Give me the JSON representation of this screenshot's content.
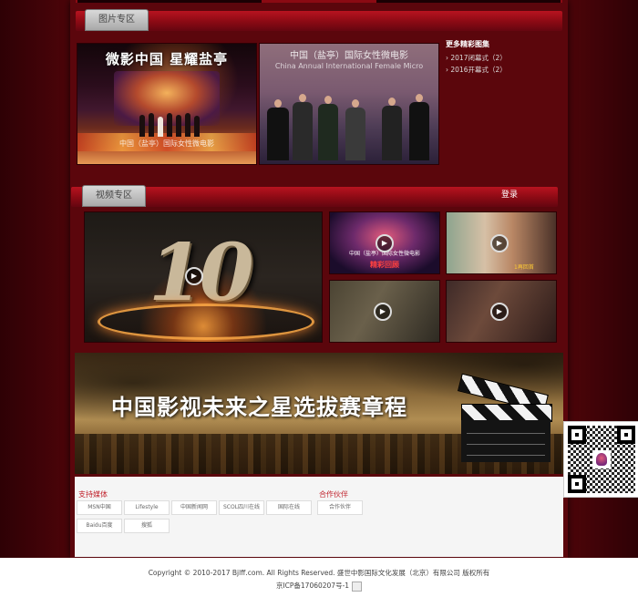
{
  "photo_section": {
    "tab_label": "图片专区",
    "photo1": {
      "caption": "微影中国 星耀盐亭",
      "banner": "中国（盐亭）国际女性微电影"
    },
    "photo2": {
      "caption": "中国（盐亭）国际女性微电影",
      "subcaption": "China Annual International Female Micro"
    },
    "more": {
      "title": "更多精彩图集",
      "items": [
        "2017闭幕式（2）",
        "2016开幕式（2）"
      ]
    }
  },
  "video_section": {
    "tab_label": "视频专区",
    "login_label": "登录",
    "videos": [
      {
        "text": "10"
      },
      {
        "text": "中国（盐亭）国际女性微电影",
        "subtext": "精彩回顾"
      },
      {
        "text": "1再回首"
      },
      {
        "text": ""
      },
      {
        "text": ""
      }
    ]
  },
  "banner": {
    "title": "中国影视未来之星选拔赛章程"
  },
  "partners": {
    "support_label": "支持媒体",
    "partner_label": "合作伙伴",
    "media_logos": [
      "MSN中国",
      "Lifestyle",
      "中国新闻网",
      "SCOL四川在线",
      "国际在线",
      "Baidu百度",
      "搜狐"
    ],
    "partner_logos": [
      "合作伙伴"
    ]
  },
  "footer": {
    "line1": "Copyright © 2010-2017 Bjlff.com. All Rights Reserved. 盛世中影国际文化发展（北京）有限公司 版权所有",
    "line2": "京ICP备17060207号-1"
  }
}
